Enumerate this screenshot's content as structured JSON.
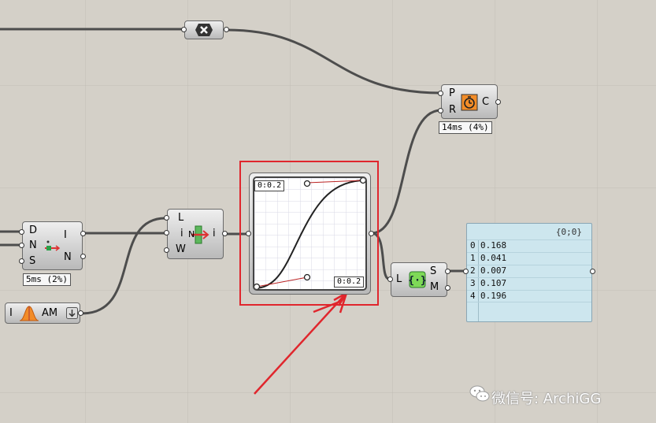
{
  "canvas": {
    "background": "#d4d0c8"
  },
  "x_component": {
    "icon": "close-x-icon"
  },
  "pc_component": {
    "inputs": [
      "P",
      "R"
    ],
    "outputs": [
      "C"
    ],
    "icon": "timer-icon",
    "timing": "14ms (4%)"
  },
  "dns_component": {
    "inputs": [
      "D",
      "N",
      "S"
    ],
    "outputs": [
      "I",
      "N"
    ],
    "timing": "5ms (2%)"
  },
  "am_component": {
    "input": "I",
    "label": "AM",
    "icon": "bell-curve-icon",
    "arrow": "down-arrow-icon"
  },
  "liw_component": {
    "inputs": [
      "L",
      "i",
      "W"
    ],
    "outputs": [
      "i"
    ],
    "center_text": "N"
  },
  "graph_mapper": {
    "top_label": "0:0.2",
    "bottom_label": "0:0.2",
    "highlight_color": "#e0262d"
  },
  "lsm_component": {
    "inputs": [
      "L"
    ],
    "outputs": [
      "S",
      "M"
    ],
    "icon": "list-brace-icon"
  },
  "panel": {
    "path": "{0;0}",
    "rows": [
      {
        "index": "0",
        "value": "0.168"
      },
      {
        "index": "1",
        "value": "0.041"
      },
      {
        "index": "2",
        "value": "0.007"
      },
      {
        "index": "3",
        "value": "0.107"
      },
      {
        "index": "4",
        "value": "0.196"
      }
    ]
  },
  "watermark": {
    "text": "微信号: ArchiGG",
    "icon": "wechat-icon"
  }
}
